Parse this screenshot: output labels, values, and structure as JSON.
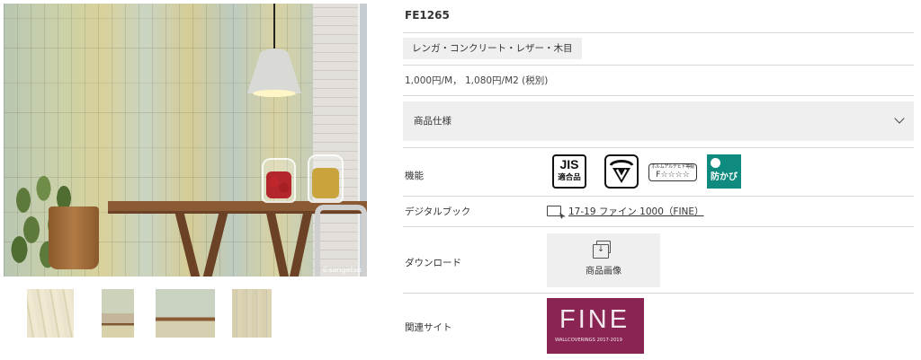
{
  "gallery": {
    "copyright": "©sangetsu",
    "thumbnails": [
      "texture",
      "room-1",
      "room-2",
      "wood-strip"
    ]
  },
  "product": {
    "code": "FE1265",
    "category_tag": "レンガ・コンクリート・レザー・木目",
    "price": "1,000円/M， 1,080円/M2 (税別)"
  },
  "spec": {
    "label": "商品仕様",
    "expanded": false
  },
  "function": {
    "label": "機能",
    "badges": {
      "jis_top": "JIS",
      "jis_bottom": "適合品",
      "f_top": "ホルムアルデヒド等級",
      "f_bottom": "F☆☆☆☆",
      "mold": "防かび"
    },
    "mold_color": "#0e8b7e"
  },
  "digital_book": {
    "label": "デジタルブック",
    "link": "17-19 ファイン 1000（FINE）"
  },
  "download": {
    "label": "ダウンロード",
    "button": "商品画像"
  },
  "related": {
    "label": "関連サイト",
    "banner_title": "FINE",
    "banner_sub": "WALLCOVERINGS 2017-2019",
    "banner_color": "#8a2452"
  }
}
